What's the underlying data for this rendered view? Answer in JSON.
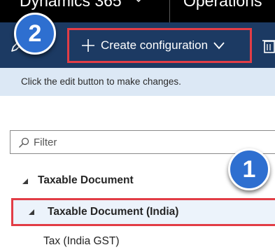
{
  "appbar": {
    "app_name": "Dynamics 365",
    "module_name": "Operations"
  },
  "actionbar": {
    "create_label": "Create configuration"
  },
  "banner": {
    "message": "Click the edit button to make changes."
  },
  "filter": {
    "placeholder": "Filter"
  },
  "tree": {
    "items": [
      {
        "label": "Taxable Document",
        "bold": true,
        "expanded": true
      },
      {
        "label": "Taxable Document (India)",
        "bold": true,
        "expanded": true,
        "selected": true
      },
      {
        "label": "Tax (India GST)",
        "bold": false
      }
    ]
  },
  "callouts": {
    "first": "1",
    "second": "2"
  },
  "colors": {
    "appbar": "#000000",
    "actionbar": "#1c3a63",
    "banner": "#dce8f5",
    "highlight": "#e23d46",
    "badge": "#2e6fd0"
  },
  "icons": [
    "edit-pen-icon",
    "plus-icon",
    "chevron-down-icon",
    "delete-icon",
    "search-icon",
    "expand-triangle-icon"
  ]
}
